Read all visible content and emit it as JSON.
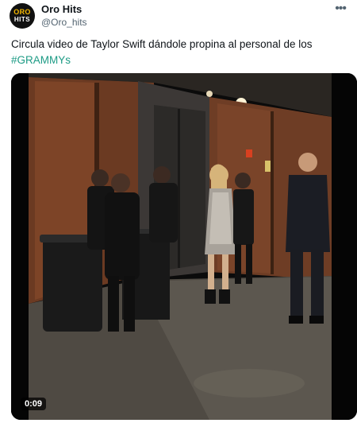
{
  "tweet": {
    "avatar": {
      "line1": "ORO",
      "line2": "HITS",
      "icon": "oro-hits-logo"
    },
    "display_name": "Oro Hits",
    "handle": "@Oro_hits",
    "more_icon": "more-horizontal-icon",
    "more_glyph": "•••",
    "text": "Circula video de Taylor Swift dándole propina al personal de los",
    "hashtag": "#GRAMMYs",
    "media": {
      "duration": "0:09",
      "type": "video"
    }
  },
  "colors": {
    "hashtag": "#1d9b85",
    "handle": "#536471",
    "avatar_bg": "#111111",
    "avatar_accent": "#f5b800"
  }
}
